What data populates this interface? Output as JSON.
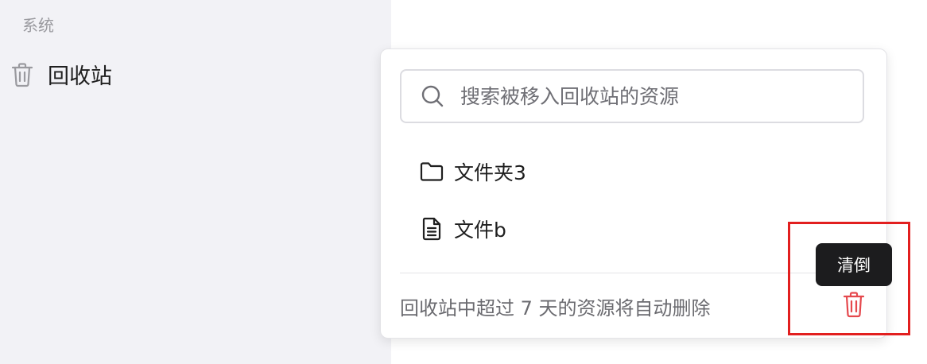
{
  "sidebar": {
    "section_label": "系统",
    "items": [
      {
        "label": "回收站",
        "icon": "trash-icon"
      }
    ]
  },
  "popover": {
    "search": {
      "placeholder": "搜索被移入回收站的资源",
      "value": ""
    },
    "items": [
      {
        "label": "文件夹3",
        "icon": "folder-icon"
      },
      {
        "label": "文件b",
        "icon": "file-icon"
      }
    ],
    "footer_text": "回收站中超过 7 天的资源将自动删除",
    "empty_button": {
      "tooltip": "清倒",
      "icon": "trash-icon"
    }
  },
  "colors": {
    "sidebar_bg": "#f2f2f6",
    "danger": "#e5484d",
    "highlight_border": "#e21f1f",
    "tooltip_bg": "#1c1c1e"
  }
}
